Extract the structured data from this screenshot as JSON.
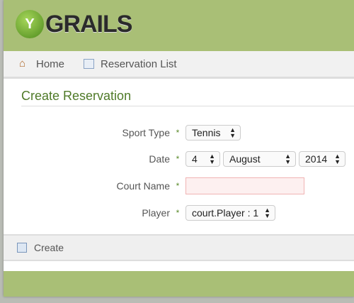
{
  "header": {
    "logo_text": "GRAILS"
  },
  "nav": {
    "home": "Home",
    "reservation_list": "Reservation List"
  },
  "page_title": "Create Reservation",
  "form": {
    "required_marker": "*",
    "sport_type": {
      "label": "Sport Type",
      "value": "Tennis"
    },
    "date": {
      "label": "Date",
      "day": "4",
      "month": "August",
      "year": "2014"
    },
    "court_name": {
      "label": "Court Name",
      "value": ""
    },
    "player": {
      "label": "Player",
      "value": "court.Player : 1"
    }
  },
  "buttons": {
    "create": "Create"
  }
}
